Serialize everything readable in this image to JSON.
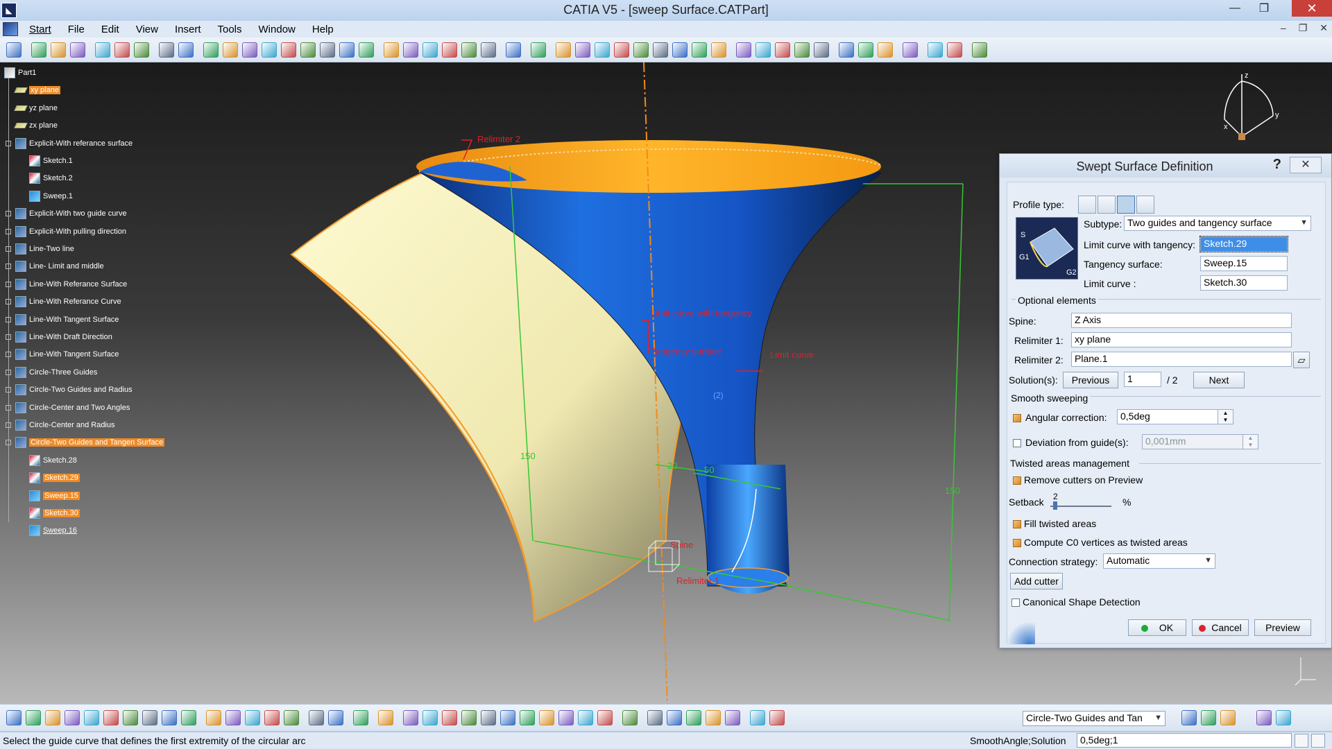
{
  "window": {
    "title": "CATIA V5 - [sweep Surface.CATPart]",
    "minimize": "—",
    "maximize": "❐",
    "close": "✕"
  },
  "menu": {
    "items": [
      "Start",
      "File",
      "Edit",
      "View",
      "Insert",
      "Tools",
      "Window",
      "Help"
    ],
    "doc_controls": [
      "–",
      "❐",
      "✕"
    ]
  },
  "tree": {
    "root": "Part1",
    "items": [
      {
        "label": "xy plane",
        "icon": "plane-icon",
        "highlight": true
      },
      {
        "label": "yz plane",
        "icon": "plane-icon"
      },
      {
        "label": "zx plane",
        "icon": "plane-icon"
      },
      {
        "label": "Explicit-With referance surface",
        "icon": "geometric-set-icon"
      },
      {
        "label": "Sketch.1",
        "icon": "sketch-icon"
      },
      {
        "label": "Sketch.2",
        "icon": "sketch-icon"
      },
      {
        "label": "Sweep.1",
        "icon": "sweep-icon"
      },
      {
        "label": "Explicit-With two guide curve",
        "icon": "geometric-set-icon"
      },
      {
        "label": "Explicit-With pulling direction",
        "icon": "geometric-set-icon"
      },
      {
        "label": "Line-Two line",
        "icon": "geometric-set-icon"
      },
      {
        "label": "Line- Limit and middle",
        "icon": "geometric-set-icon"
      },
      {
        "label": "Line-With Referance Surface",
        "icon": "geometric-set-icon"
      },
      {
        "label": "Line-With Referance Curve",
        "icon": "geometric-set-icon"
      },
      {
        "label": "Line-With Tangent Surface",
        "icon": "geometric-set-icon"
      },
      {
        "label": "Line-With Draft Direction",
        "icon": "geometric-set-icon"
      },
      {
        "label": "Line-With Tangent Surface",
        "icon": "geometric-set-icon"
      },
      {
        "label": "Circle-Three Guides",
        "icon": "geometric-set-icon"
      },
      {
        "label": "Circle-Two Guides and Radius",
        "icon": "geometric-set-icon"
      },
      {
        "label": "Circle-Center and Two Angles",
        "icon": "geometric-set-icon"
      },
      {
        "label": "Circle-Center and Radius",
        "icon": "geometric-set-icon"
      },
      {
        "label": "Circle-Two Guides and Tangen Surface",
        "icon": "geometric-set-icon",
        "highlight": true
      },
      {
        "label": "Sketch.28",
        "icon": "sketch-icon"
      },
      {
        "label": "Sketch.29",
        "icon": "sketch-icon",
        "highlight": true
      },
      {
        "label": "Sweep.15",
        "icon": "sweep-icon",
        "highlight": true
      },
      {
        "label": "Sketch.30",
        "icon": "sketch-icon",
        "highlight": true
      },
      {
        "label": "Sweep.16",
        "icon": "sweep-icon",
        "underline": true
      }
    ]
  },
  "scene": {
    "labels": {
      "relimiter2": "Relimiter 2",
      "limit_tangency": "Limit curve with tangency",
      "tangency_surface": "Tangency surface",
      "limit_curve": "Limit curve",
      "spine": "Spine",
      "relimiter1": "Relimiter 1",
      "dim_left": "150",
      "dim_right": "150",
      "dim_20": "20",
      "dim_50": "50",
      "param": "(2)"
    },
    "colors": {
      "surface_blue": "#1565d8",
      "surface_orange": "#f7a21b",
      "surface_cream": "#fbf7c6",
      "dimension_green": "#39c634",
      "annotation_red": "#e0202a",
      "axis_orange": "#f28a1a"
    }
  },
  "dialog": {
    "title": "Swept Surface Definition",
    "help": "?",
    "close": "✕",
    "profile_type_label": "Profile type:",
    "subtype_label": "Subtype:",
    "subtype_value": "Two guides and tangency surface",
    "limit_tangency_label": "Limit curve with tangency:",
    "limit_tangency_value": "Sketch.29",
    "tangency_surface_label": "Tangency surface:",
    "tangency_surface_value": "Sweep.15",
    "limit_curve_label": "Limit curve :",
    "limit_curve_value": "Sketch.30",
    "preview_labels": {
      "s": "S",
      "g1": "G1",
      "g2": "G2"
    },
    "optional_label": "Optional elements",
    "spine_label": "Spine:",
    "spine_value": "Z Axis",
    "relimiter1_label": "Relimiter 1:",
    "relimiter1_value": "xy plane",
    "relimiter2_label": "Relimiter 2:",
    "relimiter2_value": "Plane.1",
    "solutions_label": "Solution(s):",
    "previous": "Previous",
    "solution_value": "1",
    "solution_total": "/ 2",
    "next": "Next",
    "smooth_label": "Smooth sweeping",
    "angular_label": "Angular correction:",
    "angular_value": "0,5deg",
    "deviation_label": "Deviation from guide(s):",
    "deviation_value": "0,001mm",
    "twisted_label": "Twisted areas management",
    "remove_cutters": "Remove cutters on Preview",
    "setback_label": "Setback",
    "setback_value": "2",
    "setback_unit": "%",
    "fill_twisted": "Fill twisted areas",
    "compute_c0": "Compute C0 vertices as twisted areas",
    "connection_label": "Connection strategy:",
    "connection_value": "Automatic",
    "add_cutter": "Add cutter",
    "canonical": "Canonical Shape Detection",
    "ok": "OK",
    "cancel": "Cancel",
    "preview": "Preview"
  },
  "bottom_bar": {
    "command_select": "Circle-Two Guides and Tan"
  },
  "status": {
    "message": "Select the guide curve that defines the first extremity of the circular arc",
    "cmd_label": "SmoothAngle;Solution",
    "cmd_value": "0,5deg;1"
  },
  "compass": {
    "x": "x",
    "y": "y",
    "z": "z"
  }
}
